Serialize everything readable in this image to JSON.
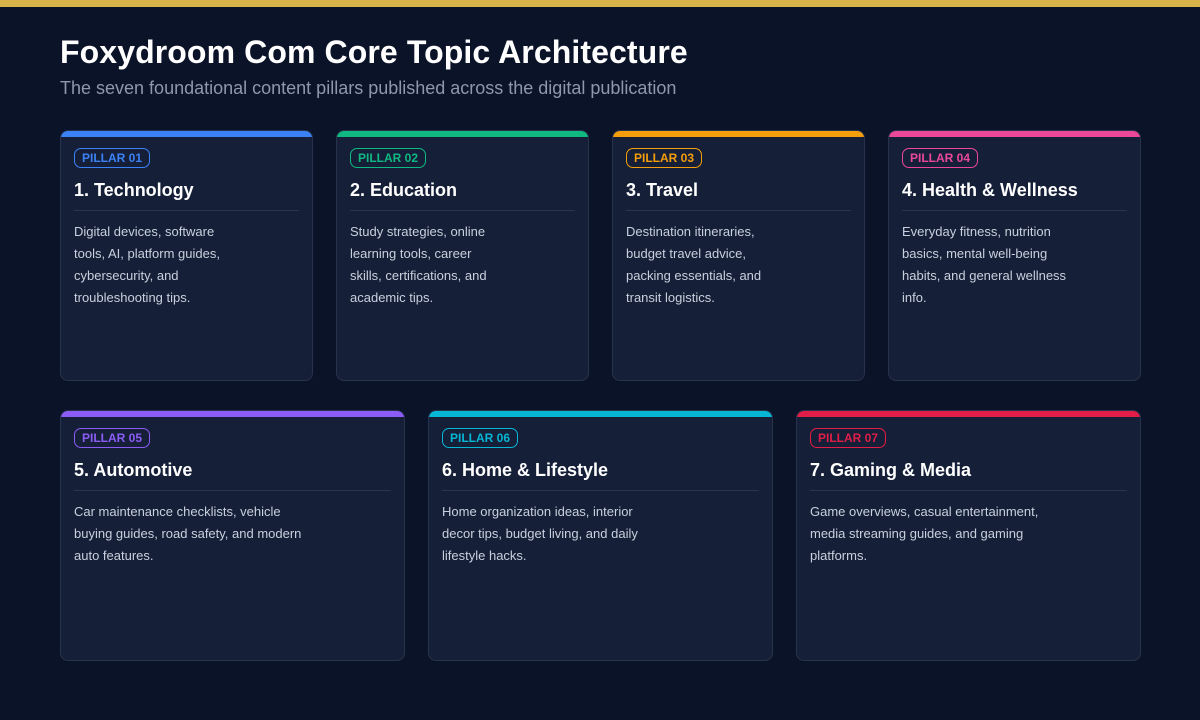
{
  "header": {
    "title": "Foxydroom Com Core Topic Architecture",
    "subtitle": "The seven foundational content pillars published across the digital publication"
  },
  "colors": {
    "background": "#0b1328",
    "top_bar": "#d8b449",
    "card_bg": "#151f38"
  },
  "pillars": [
    {
      "badge": "PILLAR 01",
      "title": "1. Technology",
      "description": "Digital devices, software tools, AI, platform guides, cybersecurity, and troubleshooting tips.",
      "color": "#3b82f6"
    },
    {
      "badge": "PILLAR 02",
      "title": "2. Education",
      "description": "Study strategies, online learning tools, career skills, certifications, and academic tips.",
      "color": "#10b981"
    },
    {
      "badge": "PILLAR 03",
      "title": "3. Travel",
      "description": "Destination itineraries, budget travel advice, packing essentials, and transit logistics.",
      "color": "#f59e0b"
    },
    {
      "badge": "PILLAR 04",
      "title": "4. Health & Wellness",
      "description": "Everyday fitness, nutrition basics, mental well-being habits, and general wellness info.",
      "color": "#ec4899"
    },
    {
      "badge": "PILLAR 05",
      "title": "5. Automotive",
      "description": "Car maintenance checklists, vehicle buying guides, road safety, and modern auto features.",
      "color": "#8b5cf6"
    },
    {
      "badge": "PILLAR 06",
      "title": "6. Home & Lifestyle",
      "description": "Home organization ideas, interior decor tips, budget living, and daily lifestyle hacks.",
      "color": "#06b6d4"
    },
    {
      "badge": "PILLAR 07",
      "title": "7. Gaming & Media",
      "description": "Game overviews, casual entertainment, media streaming guides, and gaming platforms.",
      "color": "#e11d48"
    }
  ]
}
